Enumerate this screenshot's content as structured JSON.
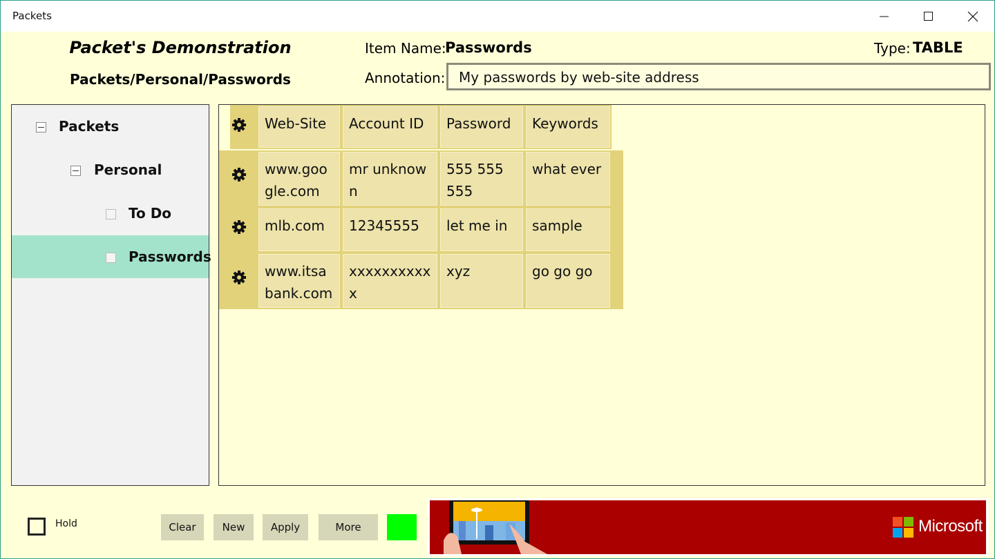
{
  "window": {
    "title": "Packets"
  },
  "header": {
    "app_title": "Packet's Demonstration",
    "path": "Packets/Personal/Passwords",
    "item_name_label": "Item Name:",
    "item_name": "Passwords",
    "type_label": "Type:",
    "type": "TABLE",
    "annotation_label": "Annotation:",
    "annotation": "My passwords by web-site address"
  },
  "tree": [
    {
      "label": "Packets",
      "expanded": true,
      "selected": false
    },
    {
      "label": "Personal",
      "expanded": true,
      "selected": false
    },
    {
      "label": "To Do",
      "expanded": false,
      "selected": false
    },
    {
      "label": "Passwords",
      "expanded": false,
      "selected": true
    }
  ],
  "table": {
    "columns": [
      "Web-Site",
      "Account ID",
      "Password",
      "Keywords"
    ],
    "rows": [
      [
        "www.google.com",
        "mr unknown",
        "555 555 555",
        "what ever"
      ],
      [
        "mlb.com",
        "12345555",
        "let me in",
        "sample"
      ],
      [
        "www.itsabank.com",
        "xxxxxxxxxxx",
        "xyz",
        "go go go"
      ]
    ]
  },
  "footer": {
    "hold_label": "Hold",
    "clear_label": "Clear",
    "new_label": "New",
    "apply_label": "Apply",
    "more_label": "More",
    "status_color": "#00ff00"
  },
  "ad": {
    "brand": "Microsoft",
    "background": "#aa0000"
  }
}
